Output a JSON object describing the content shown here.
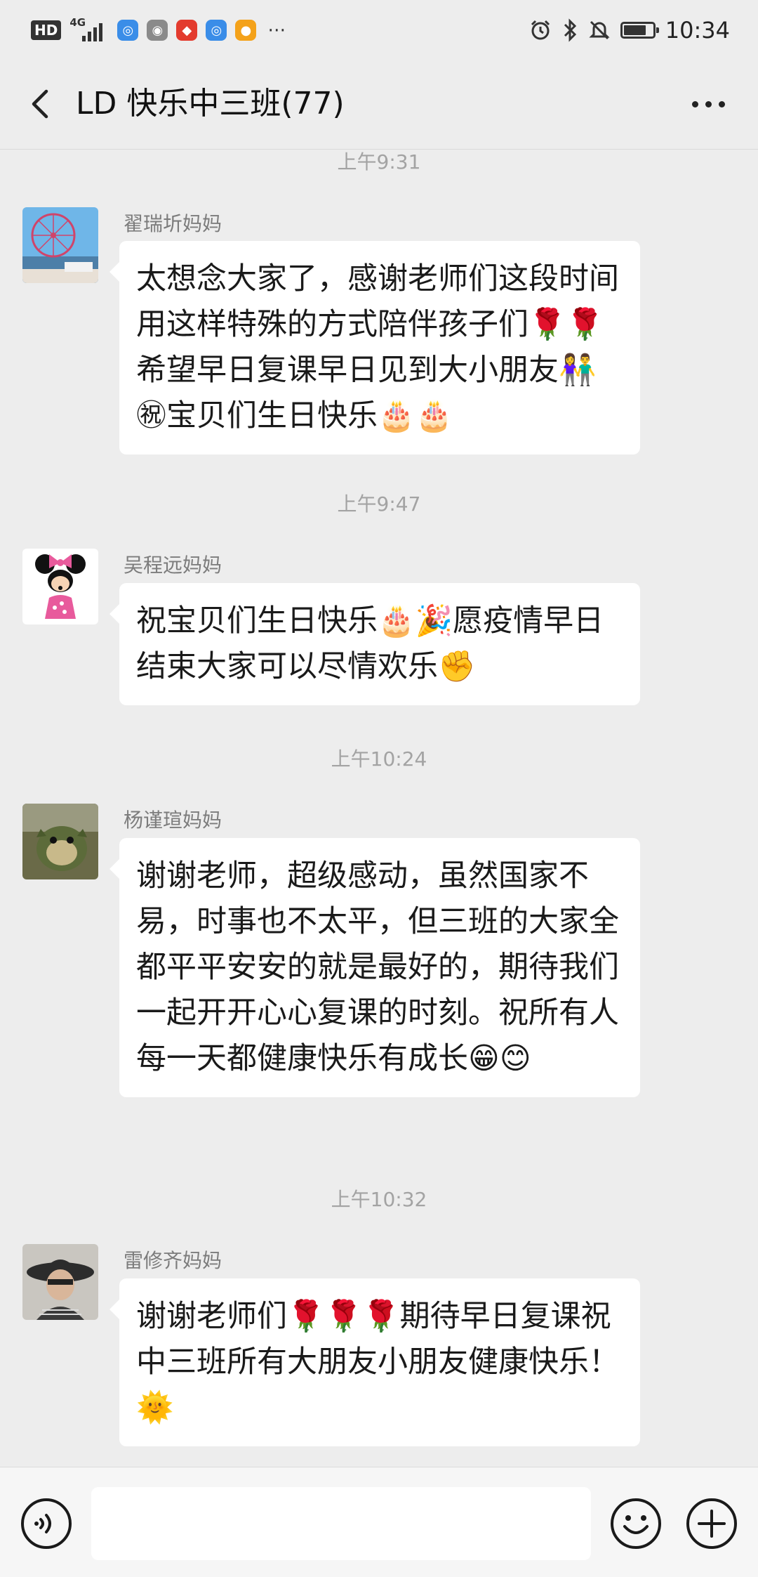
{
  "status_bar": {
    "hd": "HD",
    "network": "4G",
    "time": "10:34",
    "battery_level": 0.7
  },
  "header": {
    "title": "LD 快乐中三班(77)"
  },
  "messages": [
    {
      "timestamp": "上午9:31",
      "sender": "翟瑞圻妈妈",
      "text": "太想念大家了，感谢老师们这段时间用这样特殊的方式陪伴孩子们🌹🌹希望早日复课早日见到大小朋友👫㊗宝贝们生日快乐🎂🎂"
    },
    {
      "timestamp": "上午9:47",
      "sender": "吴程远妈妈",
      "text": "祝宝贝们生日快乐🎂🎉愿疫情早日结束大家可以尽情欢乐✊"
    },
    {
      "timestamp": "上午10:24",
      "sender": "杨谨瑄妈妈",
      "text": "谢谢老师，超级感动，虽然国家不易，时事也不太平，但三班的大家全都平平安安的就是最好的，期待我们一起开开心心复课的时刻。祝所有人每一天都健康快乐有成长😁😊"
    },
    {
      "timestamp": "上午10:32",
      "sender": "雷修齐妈妈",
      "text": "谢谢老师们🌹🌹🌹期待早日复课祝中三班所有大朋友小朋友健康快乐！🌞"
    }
  ],
  "input": {
    "value": ""
  },
  "colors": {
    "background": "#ededed",
    "bubble": "#ffffff",
    "timestamp": "#a3a3a3",
    "sender": "#7c7c7c"
  }
}
